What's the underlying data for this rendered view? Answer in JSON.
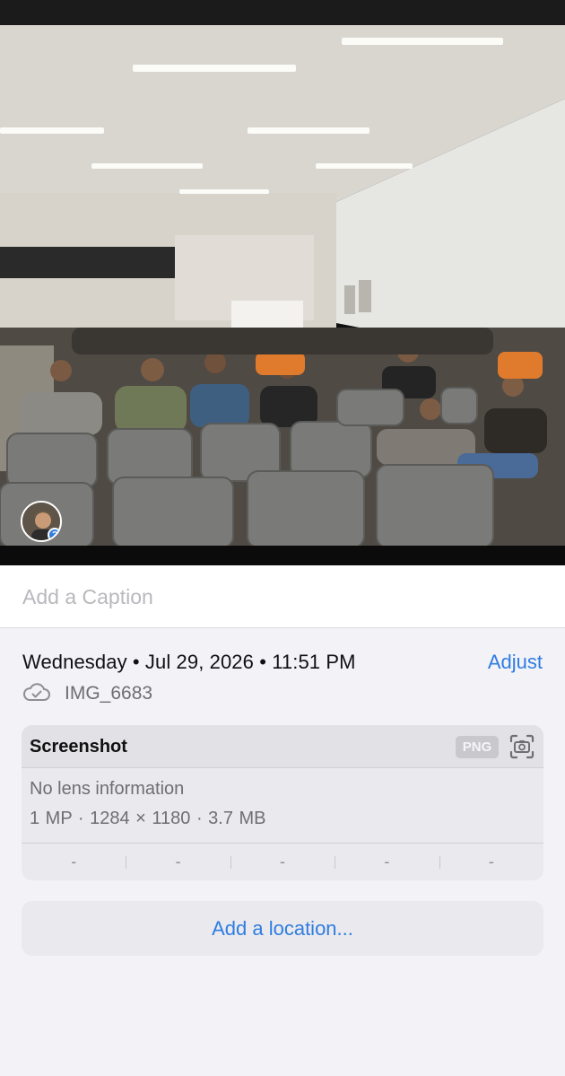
{
  "photo": {
    "description_icon": "photo",
    "people_badge_icon": "question-mark-icon",
    "people_badge_mark": "?"
  },
  "caption": {
    "placeholder": "Add a Caption"
  },
  "info": {
    "date_time": "Wednesday • Jul 29, 2026 • 11:51 PM",
    "adjust_label": "Adjust",
    "cloud_icon": "cloud-check-icon",
    "filename": "IMG_6683"
  },
  "metadata": {
    "title": "Screenshot",
    "format_badge": "PNG",
    "camera_icon": "screenshot-camera-icon",
    "lens": "No lens information",
    "specs": "1 MP · 1284 × 1180 · 3.7 MB",
    "exif_values": [
      "-",
      "-",
      "-",
      "-",
      "-"
    ]
  },
  "location": {
    "label": "Add a location..."
  },
  "colors": {
    "accent": "#2f7de1",
    "background": "#f2f2f7",
    "card": "#e9e9ee"
  }
}
